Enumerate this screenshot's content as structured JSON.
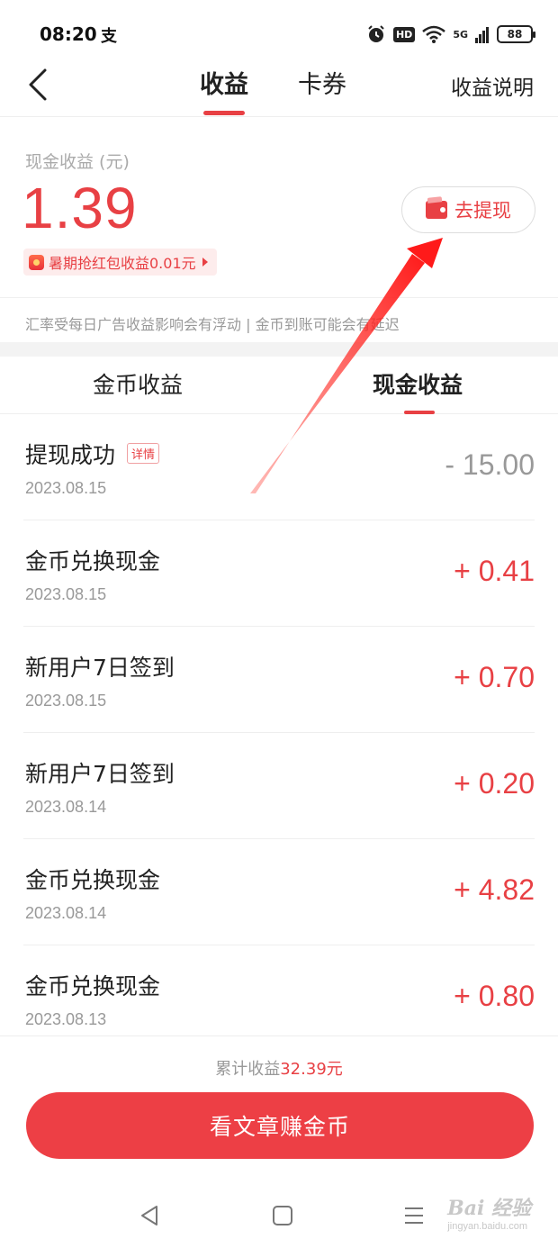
{
  "status_bar": {
    "time": "08:20",
    "app_glyph": "支",
    "hd": "HD",
    "signal": "5G",
    "battery": "88"
  },
  "nav": {
    "tab_earnings": "收益",
    "tab_coupons": "卡券",
    "explain": "收益说明"
  },
  "balance": {
    "label": "现金收益 (元)",
    "amount": "1.39",
    "promo": "暑期抢红包收益0.01元",
    "withdraw": "去提现"
  },
  "notice": "汇率受每日广告收益影响会有浮动 | 金币到账可能会有延迟",
  "sub_tabs": {
    "coin": "金币收益",
    "cash": "现金收益"
  },
  "transactions": [
    {
      "title": "提现成功",
      "detail": "详情",
      "date": "2023.08.15",
      "amount": "- 15.00"
    },
    {
      "title": "金币兑换现金",
      "date": "2023.08.15",
      "amount": "+ 0.41"
    },
    {
      "title": "新用户7日签到",
      "date": "2023.08.15",
      "amount": "+ 0.70"
    },
    {
      "title": "新用户7日签到",
      "date": "2023.08.14",
      "amount": "+ 0.20"
    },
    {
      "title": "金币兑换现金",
      "date": "2023.08.14",
      "amount": "+ 4.82"
    },
    {
      "title": "金币兑换现金",
      "date": "2023.08.13",
      "amount": "+ 0.80"
    }
  ],
  "footer": {
    "total_prefix": "累计收益",
    "total_amount": "32.39元",
    "cta": "看文章赚金币"
  },
  "watermark": {
    "main": "Bai 经验",
    "sub": "jingyan.baidu.com"
  },
  "colors": {
    "accent": "#e84044",
    "muted": "#999999",
    "text": "#222222"
  }
}
